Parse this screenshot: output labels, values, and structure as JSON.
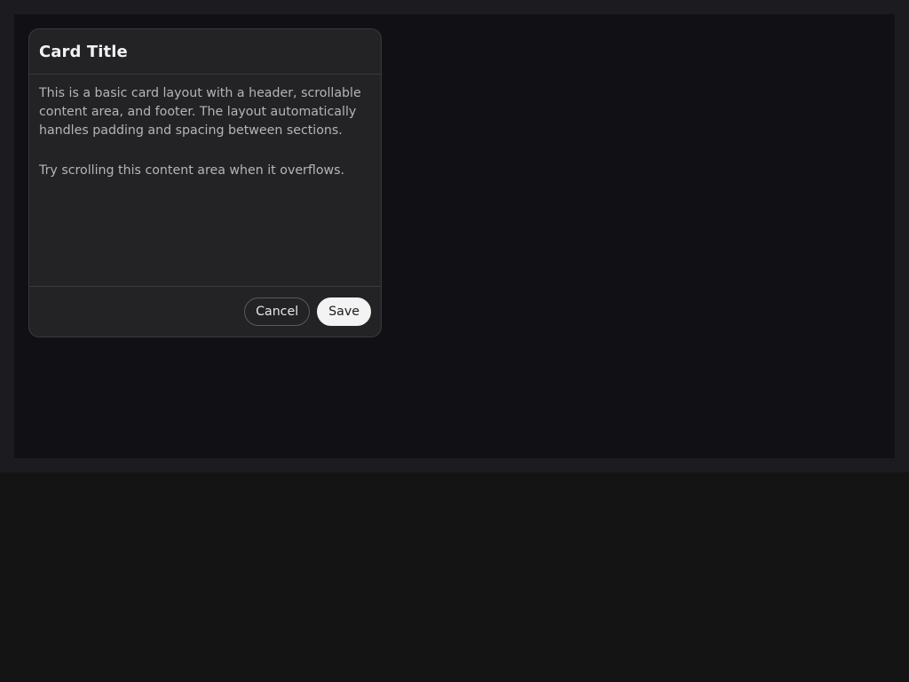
{
  "card": {
    "title": "Card Title",
    "body": {
      "paragraphs": [
        "This is a basic card layout with a header, scrollable content area, and footer. The layout automatically handles padding and spacing between sections.",
        "Try scrolling this content area when it overflows."
      ]
    },
    "footer": {
      "cancel_label": "Cancel",
      "save_label": "Save"
    }
  },
  "colors": {
    "page_background": "#141414",
    "frame_background": "#1c1b20",
    "stage_background": "#111015",
    "card_background": "#232325",
    "card_border": "#3a3a3d",
    "primary_button": "#f3f3f4"
  }
}
